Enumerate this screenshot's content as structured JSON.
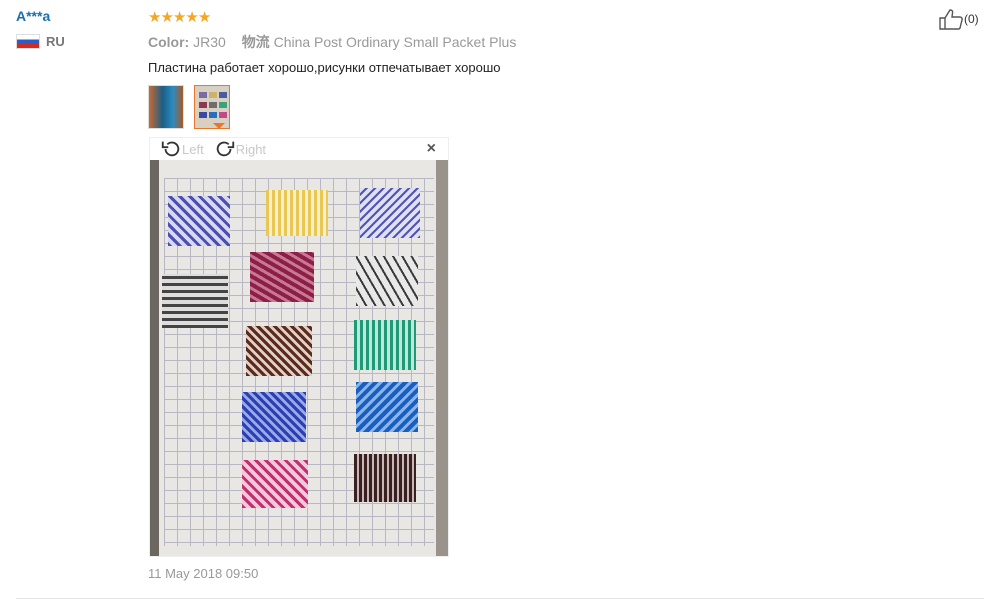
{
  "reviewer": {
    "name": "A***a",
    "country": "RU",
    "flag_icon": "russia-flag-icon"
  },
  "rating": {
    "stars": 5,
    "max": 5
  },
  "meta": {
    "color_label": "Color:",
    "color_value": "JR30",
    "shipping_label": "物流",
    "shipping_value": "China Post Ordinary Small Packet Plus"
  },
  "review": {
    "text": "Пластина работает хорошо,рисунки отпечатывает хорошо",
    "date": "11 May 2018 09:50"
  },
  "viewer": {
    "rotate_left": "Left",
    "rotate_right": "Right",
    "close_symbol": "×"
  },
  "helpful": {
    "count": "(0)"
  },
  "colors": {
    "accent": "#e8762d",
    "username": "#1a6fb0",
    "star": "#f5a623"
  }
}
